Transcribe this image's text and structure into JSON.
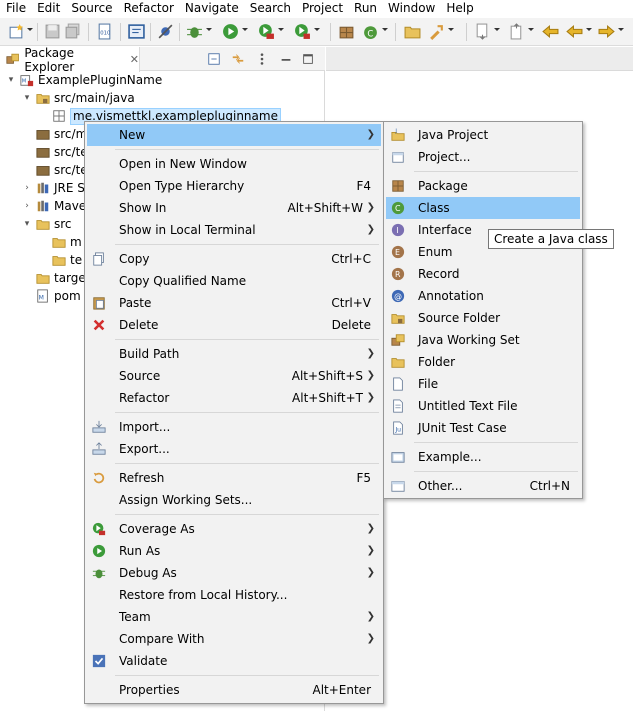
{
  "menubar": [
    "File",
    "Edit",
    "Source",
    "Refactor",
    "Navigate",
    "Search",
    "Project",
    "Run",
    "Window",
    "Help"
  ],
  "explorer": {
    "tab_title": "Package Explorer",
    "tab_close": "✕",
    "tree": [
      {
        "label": "ExamplePluginName",
        "twisty": "▾",
        "icon": "plugin-project-icon"
      },
      {
        "label": "src/main/java",
        "twisty": "▾",
        "icon": "source-folder-icon"
      },
      {
        "label": "me.vismettkl.examplepluginname",
        "twisty": "",
        "icon": "package-icon"
      },
      {
        "label": "src/m",
        "twisty": "",
        "icon": "source-folder-icon"
      },
      {
        "label": "src/te",
        "twisty": "",
        "icon": "source-folder-icon"
      },
      {
        "label": "src/te",
        "twisty": "",
        "icon": "source-folder-icon"
      },
      {
        "label": "JRE S",
        "twisty": "›",
        "icon": "library-icon"
      },
      {
        "label": "Mave",
        "twisty": "›",
        "icon": "library-icon"
      },
      {
        "label": "src",
        "twisty": "▾",
        "icon": "folder-icon"
      },
      {
        "label": "m",
        "twisty": "",
        "icon": "folder-icon"
      },
      {
        "label": "te",
        "twisty": "",
        "icon": "folder-icon"
      },
      {
        "label": "targe",
        "twisty": "",
        "icon": "folder-icon"
      },
      {
        "label": "pom",
        "twisty": "",
        "icon": "maven-file-icon"
      }
    ]
  },
  "context_menu": {
    "items": [
      {
        "label": "New",
        "shortcut": "",
        "submenu": true,
        "icon": ""
      },
      {
        "label": "Open in New Window",
        "shortcut": "",
        "submenu": false,
        "icon": ""
      },
      {
        "label": "Open Type Hierarchy",
        "shortcut": "F4",
        "submenu": false,
        "icon": ""
      },
      {
        "label": "Show In",
        "shortcut": "Alt+Shift+W",
        "submenu": true,
        "icon": ""
      },
      {
        "label": "Show in Local Terminal",
        "shortcut": "",
        "submenu": true,
        "icon": ""
      },
      {
        "label": "Copy",
        "shortcut": "Ctrl+C",
        "submenu": false,
        "icon": "copy-icon"
      },
      {
        "label": "Copy Qualified Name",
        "shortcut": "",
        "submenu": false,
        "icon": ""
      },
      {
        "label": "Paste",
        "shortcut": "Ctrl+V",
        "submenu": false,
        "icon": "paste-icon"
      },
      {
        "label": "Delete",
        "shortcut": "Delete",
        "submenu": false,
        "icon": "delete-icon"
      },
      {
        "label": "Build Path",
        "shortcut": "",
        "submenu": true,
        "icon": ""
      },
      {
        "label": "Source",
        "shortcut": "Alt+Shift+S",
        "submenu": true,
        "icon": ""
      },
      {
        "label": "Refactor",
        "shortcut": "Alt+Shift+T",
        "submenu": true,
        "icon": ""
      },
      {
        "label": "Import...",
        "shortcut": "",
        "submenu": false,
        "icon": "import-icon"
      },
      {
        "label": "Export...",
        "shortcut": "",
        "submenu": false,
        "icon": "export-icon"
      },
      {
        "label": "Refresh",
        "shortcut": "F5",
        "submenu": false,
        "icon": "refresh-icon"
      },
      {
        "label": "Assign Working Sets...",
        "shortcut": "",
        "submenu": false,
        "icon": ""
      },
      {
        "label": "Coverage As",
        "shortcut": "",
        "submenu": true,
        "icon": "coverage-icon"
      },
      {
        "label": "Run As",
        "shortcut": "",
        "submenu": true,
        "icon": "run-icon"
      },
      {
        "label": "Debug As",
        "shortcut": "",
        "submenu": true,
        "icon": "debug-icon"
      },
      {
        "label": "Restore from Local History...",
        "shortcut": "",
        "submenu": false,
        "icon": ""
      },
      {
        "label": "Team",
        "shortcut": "",
        "submenu": true,
        "icon": ""
      },
      {
        "label": "Compare With",
        "shortcut": "",
        "submenu": true,
        "icon": ""
      },
      {
        "label": "Validate",
        "shortcut": "",
        "submenu": false,
        "icon": "validate-check-icon"
      },
      {
        "label": "Properties",
        "shortcut": "Alt+Enter",
        "submenu": false,
        "icon": ""
      }
    ]
  },
  "new_submenu": {
    "items": [
      {
        "label": "Java Project",
        "shortcut": "",
        "icon": "java-project-icon"
      },
      {
        "label": "Project...",
        "shortcut": "",
        "icon": "project-icon"
      },
      {
        "label": "Package",
        "shortcut": "",
        "icon": "package-icon"
      },
      {
        "label": "Class",
        "shortcut": "",
        "icon": "class-icon"
      },
      {
        "label": "Interface",
        "shortcut": "",
        "icon": "interface-icon"
      },
      {
        "label": "Enum",
        "shortcut": "",
        "icon": "enum-icon"
      },
      {
        "label": "Record",
        "shortcut": "",
        "icon": "record-icon"
      },
      {
        "label": "Annotation",
        "shortcut": "",
        "icon": "annotation-icon"
      },
      {
        "label": "Source Folder",
        "shortcut": "",
        "icon": "source-folder-icon"
      },
      {
        "label": "Java Working Set",
        "shortcut": "",
        "icon": "working-set-icon"
      },
      {
        "label": "Folder",
        "shortcut": "",
        "icon": "folder-icon"
      },
      {
        "label": "File",
        "shortcut": "",
        "icon": "file-icon"
      },
      {
        "label": "Untitled Text File",
        "shortcut": "",
        "icon": "text-file-icon"
      },
      {
        "label": "JUnit Test Case",
        "shortcut": "",
        "icon": "junit-icon"
      },
      {
        "label": "Example...",
        "shortcut": "",
        "icon": "example-icon"
      },
      {
        "label": "Other...",
        "shortcut": "Ctrl+N",
        "icon": "other-wizard-icon"
      }
    ]
  },
  "tooltip": "Create a Java class",
  "colors": {
    "menu_bg": "#f2f2f2",
    "menu_highlight": "#91c9f7",
    "selection": "#cce8ff",
    "folder": "#e8c25c",
    "package": "#8b6d3f"
  }
}
